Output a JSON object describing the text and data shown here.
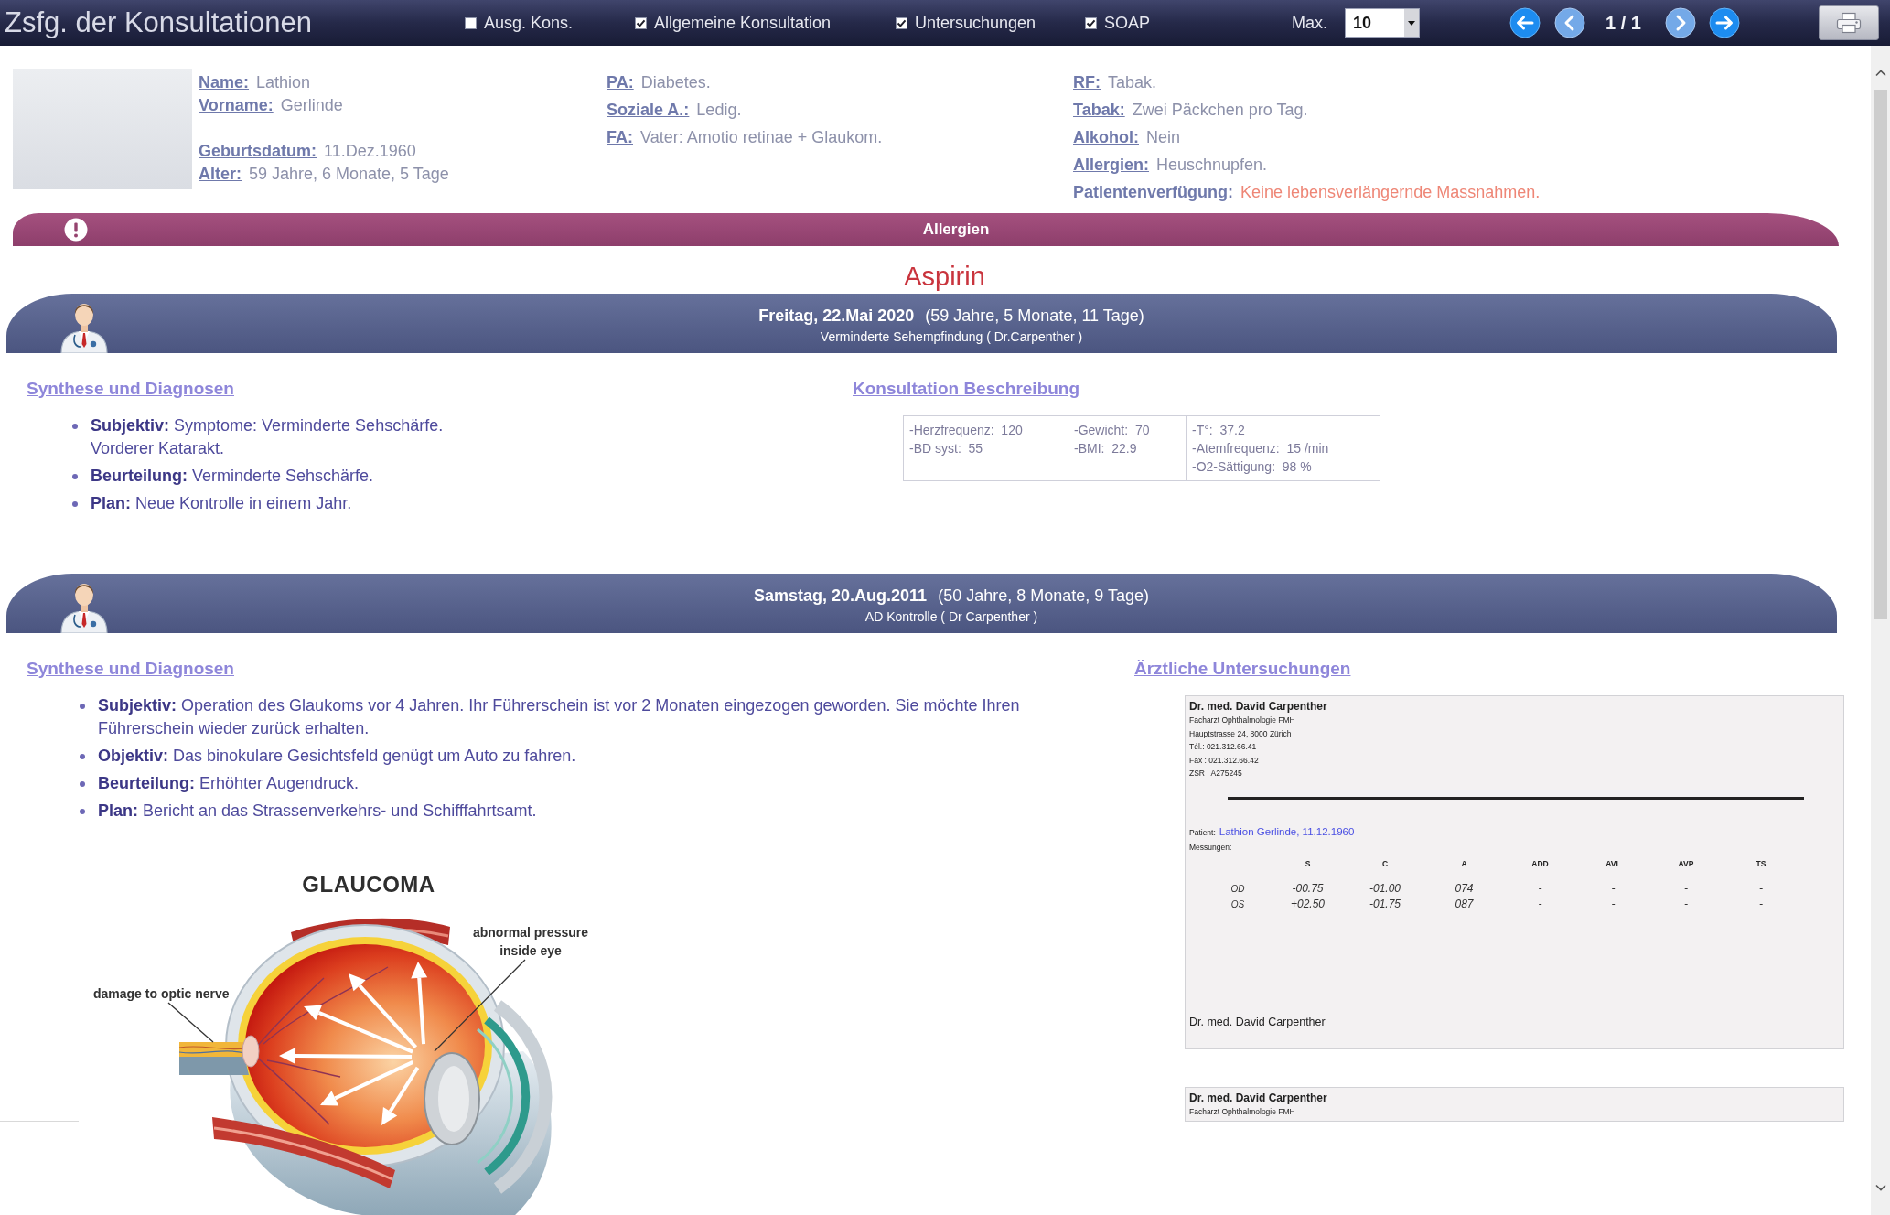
{
  "toolbar": {
    "title": "Zsfg. der Konsultationen",
    "filters": [
      {
        "label": "Ausg. Kons.",
        "checked": false
      },
      {
        "label": "Allgemeine Konsultation",
        "checked": true
      },
      {
        "label": "Untersuchungen",
        "checked": true
      },
      {
        "label": "SOAP",
        "checked": true
      }
    ],
    "max_label": "Max.",
    "max_value": "10",
    "nav": [
      {
        "kind": "first",
        "disabled": false
      },
      {
        "kind": "prev",
        "disabled": true
      },
      {
        "kind": "next",
        "disabled": true
      },
      {
        "kind": "last",
        "disabled": false
      }
    ],
    "page": "1 / 1"
  },
  "patient": {
    "columns": [
      {
        "groups": [
          [
            {
              "label": "Name:",
              "value": "Lathion",
              "alert": false
            },
            {
              "label": "Vorname:",
              "value": "Gerlinde",
              "alert": false
            }
          ],
          [
            {
              "label": "Geburtsdatum:",
              "value": "11.Dez.1960",
              "alert": false
            },
            {
              "label": "Alter:",
              "value": "59 Jahre, 6 Monate, 5 Tage",
              "alert": false
            }
          ]
        ]
      },
      {
        "groups": [
          [
            {
              "label": "PA:",
              "value": "Diabetes.",
              "alert": false
            },
            {
              "label": "Soziale A.:",
              "value": "Ledig.",
              "alert": false
            },
            {
              "label": "FA:",
              "value": "Vater: Amotio retinae + Glaukom.",
              "alert": false
            }
          ]
        ]
      },
      {
        "groups": [
          [
            {
              "label": "RF:",
              "value": "Tabak.",
              "alert": false
            },
            {
              "label": "Tabak:",
              "value": "Zwei Päckchen pro Tag.",
              "alert": false
            },
            {
              "label": "Alkohol:",
              "value": "Nein",
              "alert": false
            },
            {
              "label": "Allergien:",
              "value": "Heuschnupfen.",
              "alert": false
            },
            {
              "label": "Patientenverfügung:",
              "value": "Keine lebensverlängernde Massnahmen.",
              "alert": true
            }
          ]
        ]
      }
    ]
  },
  "allergies": {
    "title": "Allergien",
    "items": [
      "Aspirin"
    ]
  },
  "consultations": [
    {
      "date": "Freitag, 22.Mai 2020",
      "age": "(59 Jahre, 5 Monate, 11 Tage)",
      "subtitle": "Verminderte Sehempfindung ( Dr.Carpenther )",
      "synthesis": {
        "title": "Synthese und Diagnosen",
        "items": [
          "**Subjektiv:** Symptome: Verminderte Sehschärfe.\nVorderer Katarakt.",
          "**Beurteilung:** Verminderte Sehschärfe.",
          "**Plan:** Neue Kontrolle in einem Jahr."
        ]
      },
      "details": {
        "kind": "vitals",
        "title": "Konsultation Beschreibung",
        "cells": [
          [
            "-Herzfrequenz:  120",
            "-BD syst:  55"
          ],
          [
            "-Gewicht:  70",
            "-BMI:  22.9"
          ],
          [
            "-T°:  37.2",
            "-Atemfrequenz:  15 /min",
            "-O2-Sättigung:  98 %"
          ]
        ]
      }
    },
    {
      "date": "Samstag, 20.Aug.2011",
      "age": "(50 Jahre, 8 Monate, 9 Tage)",
      "subtitle": "AD Kontrolle ( Dr Carpenther )",
      "synthesis": {
        "title": "Synthese und Diagnosen",
        "items": [
          "**Subjektiv:** Operation des Glaukoms vor 4 Jahren. Ihr Führerschein ist vor 2 Monaten eingezogen geworden. Sie möchte Ihren Führerschein wieder zurück erhalten.",
          "**Objektiv:** Das binokulare Gesichtsfeld genügt um Auto zu fahren.",
          "**Beurteilung:** Erhöhter Augendruck.",
          "**Plan:** Bericht an das Strassenverkehrs- und Schifffahrtsamt."
        ],
        "figure": {
          "title": "GLAUCOMA",
          "labels": [
            "abnormal pressure inside eye",
            "damage to optic nerve"
          ]
        }
      },
      "details": {
        "kind": "exams",
        "title": "Ärztliche Untersuchungen",
        "documents": [
          {
            "doctor": "Dr. med. David Carpenther",
            "lines": [
              "Facharzt Ophthalmologie FMH",
              "Hauptstrasse 24, 8000 Zürich",
              "Tél.: 021.312.66.41",
              "Fax : 021.312.66.42",
              "ZSR : A275245"
            ],
            "patient_label": "Patient:",
            "patient": "Lathion Gerlinde, 11.12.1960",
            "measurements_label": "Messungen:",
            "columns": [
              "S",
              "C",
              "A",
              "ADD",
              "AVL",
              "AVP",
              "TS"
            ],
            "rows": [
              {
                "eye": "OD",
                "values": [
                  "-00.75",
                  "-01.00",
                  "074",
                  "-",
                  "-",
                  "-",
                  "-"
                ]
              },
              {
                "eye": "OS",
                "values": [
                  "+02.50",
                  "-01.75",
                  "087",
                  "-",
                  "-",
                  "-",
                  "-"
                ]
              }
            ],
            "signature": "Dr. med. David Carpenther"
          },
          {
            "doctor": "Dr. med. David Carpenther",
            "lines": [
              "Facharzt Ophthalmologie FMH"
            ]
          }
        ]
      }
    }
  ]
}
